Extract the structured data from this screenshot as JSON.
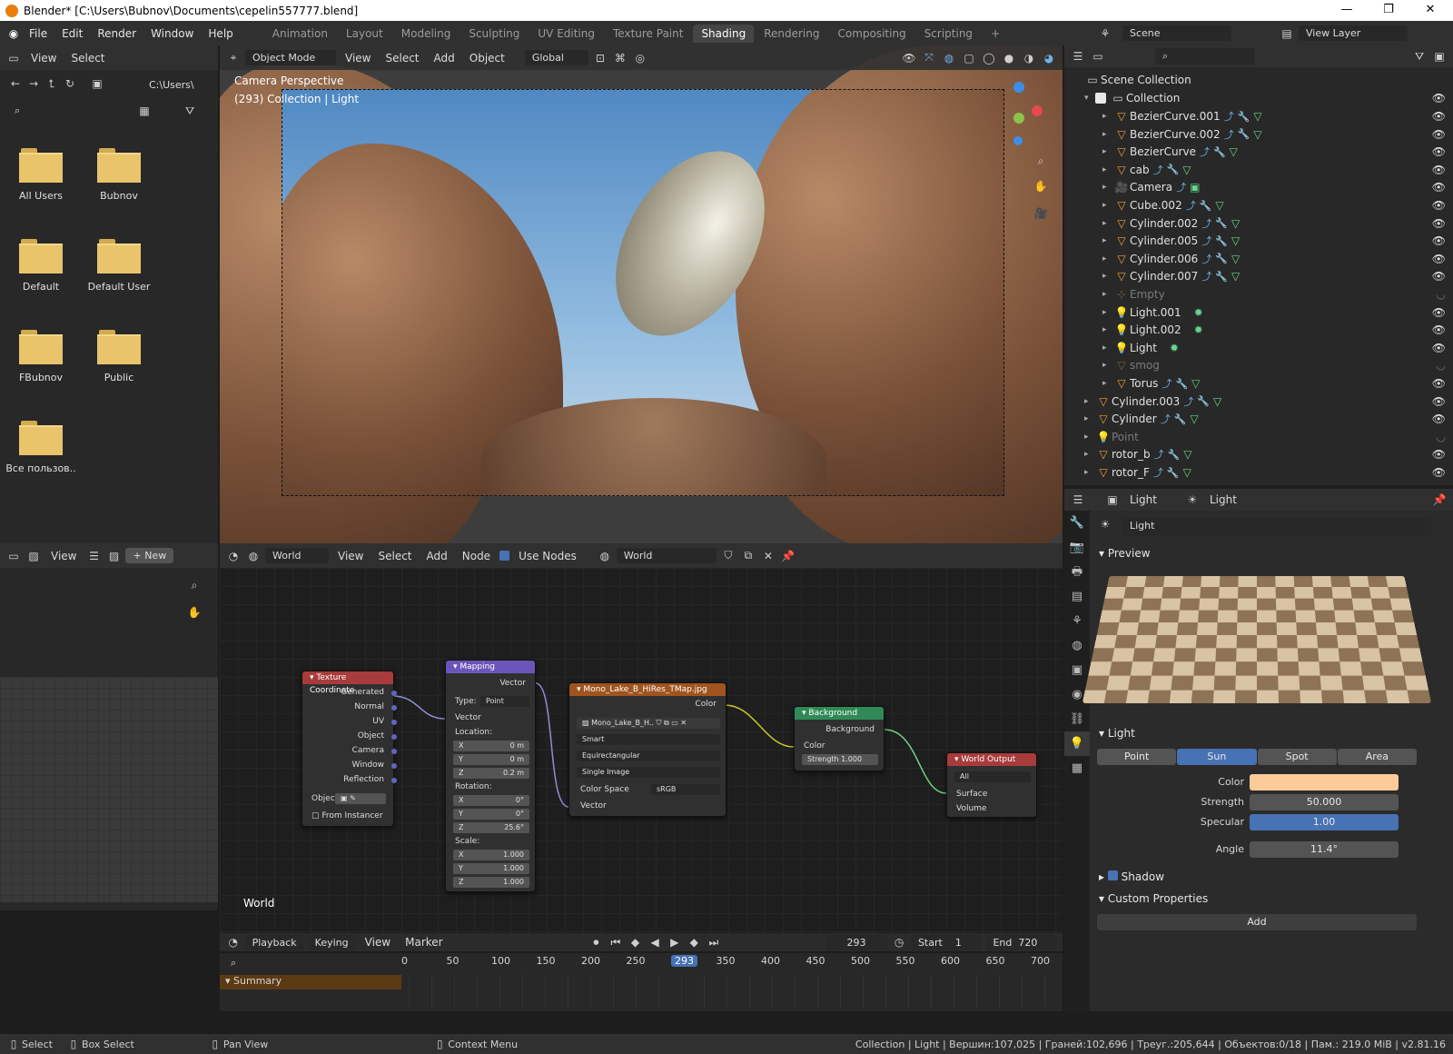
{
  "title": "Blender* [C:\\Users\\Bubnov\\Documents\\cepelin557777.blend]",
  "menus": [
    "File",
    "Edit",
    "Render",
    "Window",
    "Help"
  ],
  "workspaces": [
    "Animation",
    "Layout",
    "Modeling",
    "Sculpting",
    "UV Editing",
    "Texture Paint",
    "Shading",
    "Rendering",
    "Compositing",
    "Scripting"
  ],
  "active_workspace": "Shading",
  "scene_name": "Scene",
  "view_layer": "View Layer",
  "filebrowser": {
    "view": "View",
    "select": "Select",
    "path": "C:\\Users\\",
    "folders": [
      "All Users",
      "Bubnov",
      "Default",
      "Default User",
      "FBubnov",
      "Public",
      "Все пользов.."
    ]
  },
  "viewport": {
    "mode": "Object Mode",
    "view": "View",
    "select": "Select",
    "add": "Add",
    "object": "Object",
    "orientation": "Global",
    "overlay1": "Camera Perspective",
    "overlay2": "(293) Collection | Light"
  },
  "outliner": {
    "root": "Scene Collection",
    "collection": "Collection",
    "items": [
      {
        "name": "BezierCurve.001",
        "dim": false,
        "lvl": 2,
        "kind": "mesh"
      },
      {
        "name": "BezierCurve.002",
        "dim": false,
        "lvl": 2,
        "kind": "mesh"
      },
      {
        "name": "BezierCurve",
        "dim": false,
        "lvl": 2,
        "kind": "mesh"
      },
      {
        "name": "cab",
        "dim": false,
        "lvl": 2,
        "kind": "mesh"
      },
      {
        "name": "Camera",
        "dim": false,
        "lvl": 2,
        "kind": "camera"
      },
      {
        "name": "Cube.002",
        "dim": false,
        "lvl": 2,
        "kind": "mesh"
      },
      {
        "name": "Cylinder.002",
        "dim": false,
        "lvl": 2,
        "kind": "mesh"
      },
      {
        "name": "Cylinder.005",
        "dim": false,
        "lvl": 2,
        "kind": "mesh"
      },
      {
        "name": "Cylinder.006",
        "dim": false,
        "lvl": 2,
        "kind": "mesh"
      },
      {
        "name": "Cylinder.007",
        "dim": false,
        "lvl": 2,
        "kind": "mesh"
      },
      {
        "name": "Empty",
        "dim": true,
        "lvl": 2,
        "kind": "empty"
      },
      {
        "name": "Light.001",
        "dim": false,
        "lvl": 2,
        "kind": "light"
      },
      {
        "name": "Light.002",
        "dim": false,
        "lvl": 2,
        "kind": "light"
      },
      {
        "name": "Light",
        "dim": false,
        "lvl": 2,
        "kind": "light"
      },
      {
        "name": "smog",
        "dim": true,
        "lvl": 2,
        "kind": "mesh"
      },
      {
        "name": "Torus",
        "dim": false,
        "lvl": 2,
        "kind": "mesh"
      },
      {
        "name": "Cylinder.003",
        "dim": false,
        "lvl": 1,
        "kind": "mesh"
      },
      {
        "name": "Cylinder",
        "dim": false,
        "lvl": 1,
        "kind": "mesh"
      },
      {
        "name": "Point",
        "dim": true,
        "lvl": 1,
        "kind": "light"
      },
      {
        "name": "rotor_b",
        "dim": false,
        "lvl": 1,
        "kind": "mesh"
      },
      {
        "name": "rotor_F",
        "dim": false,
        "lvl": 1,
        "kind": "mesh"
      }
    ]
  },
  "props": {
    "breadcrumb1": "Light",
    "breadcrumb2": "Light",
    "datablock": "Light",
    "preview": "Preview",
    "light_section": "Light",
    "types": [
      "Point",
      "Sun",
      "Spot",
      "Area"
    ],
    "active_type": "Sun",
    "color_label": "Color",
    "color": "#fccb98",
    "strength_label": "Strength",
    "strength": "50.000",
    "specular_label": "Specular",
    "specular": "1.00",
    "angle_label": "Angle",
    "angle": "11.4°",
    "shadow": "Shadow",
    "custom": "Custom Properties",
    "add": "Add"
  },
  "nodeeditor": {
    "type": "World",
    "view": "View",
    "select": "Select",
    "add": "Add",
    "node": "Node",
    "use_nodes": "Use Nodes",
    "world": "World",
    "label": "World"
  },
  "nodes": {
    "texcoord": {
      "title": "Texture Coordinate",
      "outs": [
        "Generated",
        "Normal",
        "UV",
        "Object",
        "Camera",
        "Window",
        "Reflection"
      ],
      "obj": "Objec",
      "from_instancer": "From Instancer"
    },
    "mapping": {
      "title": "Mapping",
      "out": "Vector",
      "type_label": "Type:",
      "type": "Point",
      "vector": "Vector",
      "location": "Location:",
      "loc": [
        "0 m",
        "0 m",
        "0.2 m"
      ],
      "rotation": "Rotation:",
      "rot": [
        "0°",
        "0°",
        "25.6°"
      ],
      "scale": "Scale:",
      "scl": [
        "1.000",
        "1.000",
        "1.000"
      ],
      "axes": [
        "X",
        "Y",
        "Z"
      ]
    },
    "image": {
      "title": "Mono_Lake_B_HiRes_TMap.jpg",
      "color": "Color",
      "img": "Mono_Lake_B_H..",
      "interp": "Smart",
      "proj": "Equirectangular",
      "src": "Single Image",
      "cs_label": "Color Space",
      "cs": "sRGB",
      "vector": "Vector"
    },
    "background": {
      "title": "Background",
      "out": "Background",
      "color": "Color",
      "strength_label": "Strength",
      "strength": "1.000"
    },
    "output": {
      "title": "World Output",
      "target": "All",
      "surface": "Surface",
      "volume": "Volume"
    }
  },
  "uv": {
    "view": "View",
    "new": "New"
  },
  "timeline": {
    "playback": "Playback",
    "keying": "Keying",
    "view": "View",
    "marker": "Marker",
    "frame": "293",
    "start_label": "Start",
    "start": "1",
    "end_label": "End",
    "end": "720",
    "summary": "Summary",
    "ticks": [
      "0",
      "50",
      "100",
      "150",
      "200",
      "250",
      "293",
      "350",
      "400",
      "450",
      "500",
      "550",
      "600",
      "650",
      "700"
    ]
  },
  "status": {
    "select": "Select",
    "box": "Box Select",
    "pan": "Pan View",
    "ctx": "Context Menu",
    "info": "Collection | Light | Вершин:107,025 | Граней:102,696 | Треуг.:205,644 | Объектов:0/18 | Пам.: 219.0 MiB | v2.81.16"
  }
}
